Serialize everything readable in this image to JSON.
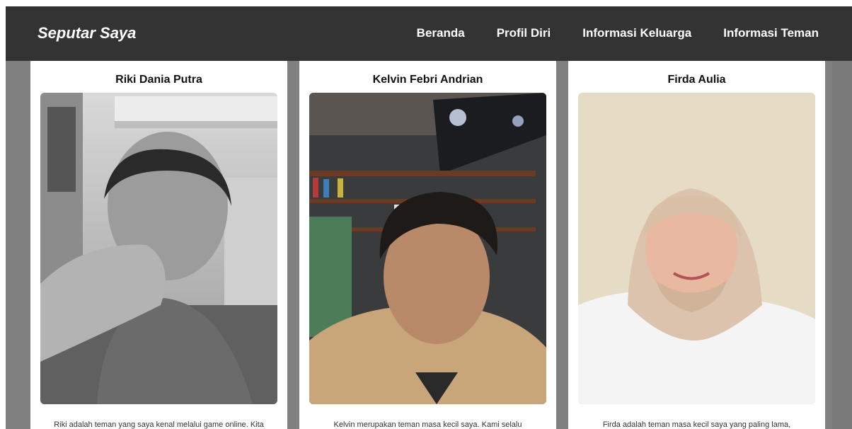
{
  "navbar": {
    "brand": "Seputar Saya",
    "links": [
      {
        "label": "Beranda"
      },
      {
        "label": "Profil Diri"
      },
      {
        "label": "Informasi Keluarga"
      },
      {
        "label": "Informasi Teman"
      }
    ]
  },
  "friends": [
    {
      "name": "Riki Dania Putra",
      "description": "Riki adalah teman yang saya kenal melalui game online. Kita"
    },
    {
      "name": "Kelvin Febri Andrian",
      "description": "Kelvin merupakan teman masa kecil saya. Kami selalu"
    },
    {
      "name": "Firda Aulia",
      "description": "Firda adalah teman masa kecil saya yang paling lama,"
    }
  ],
  "colors": {
    "navbar_bg": "#333333",
    "page_bg": "#808080",
    "card_bg": "#ffffff"
  }
}
